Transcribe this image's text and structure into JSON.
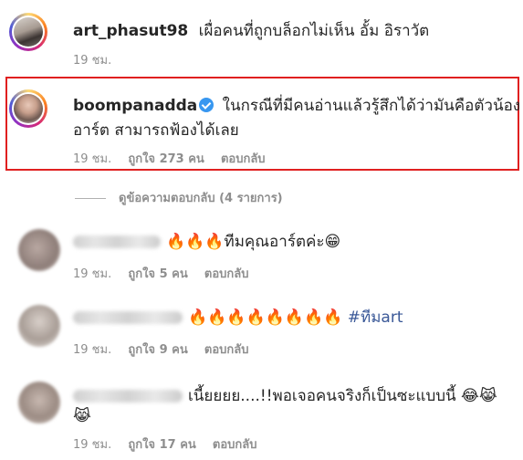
{
  "comments": [
    {
      "username": "art_phasut98",
      "text": "เผื่อคนที่ถูกบล็อกไม่เห็น อั้ม อิราวัต",
      "time": "19 ชม."
    },
    {
      "username": "boompanadda",
      "text_line1": "ในกรณีที่มีคนอ่านแล้วรู้สึกได้ว่ามันคือตัวน้อง",
      "text_line2": "อาร์ต สามารถฟ้องได้เลย",
      "time": "19 ชม.",
      "likes": "ถูกใจ 273 คน",
      "reply": "ตอบกลับ"
    }
  ],
  "view_replies": "ดูข้อความตอบกลับ (4 รายการ)",
  "replies": [
    {
      "text": "🔥🔥🔥ทีมคุณอาร์ตค่ะ😁",
      "time": "19 ชม.",
      "likes": "ถูกใจ 5 คน",
      "reply": "ตอบกลับ"
    },
    {
      "text": "🔥🔥🔥🔥🔥🔥🔥🔥",
      "hashtag": "#ทีมart",
      "time": "19 ชม.",
      "likes": "ถูกใจ 9 คน",
      "reply": "ตอบกลับ"
    },
    {
      "text_line1": "เนี้ยยยย....!!พอเจอคนจริงก็เป็นซะแบบนี้ 😂😹",
      "text_line2": "😹",
      "time": "19 ชม.",
      "likes": "ถูกใจ 17 คน",
      "reply": "ตอบกลับ"
    }
  ],
  "colors": {
    "highlight": "#e02020",
    "verified": "#3897f0",
    "meta": "#8e8e8e",
    "hashtag": "#3b5998"
  },
  "icons": [
    "verified-badge-icon",
    "avatar-story-ring"
  ]
}
